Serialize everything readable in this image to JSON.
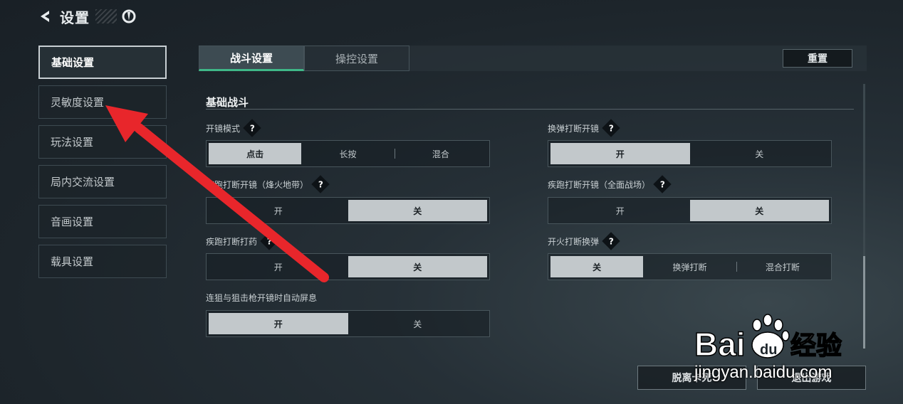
{
  "header": {
    "back_icon": "back-arrow-icon",
    "title": "设置",
    "logo_icon": "game-logo-icon"
  },
  "sidebar": {
    "items": [
      {
        "label": "基础设置",
        "active": true
      },
      {
        "label": "灵敏度设置"
      },
      {
        "label": "玩法设置"
      },
      {
        "label": "局内交流设置"
      },
      {
        "label": "音画设置"
      },
      {
        "label": "载具设置"
      }
    ]
  },
  "tabs": [
    {
      "label": "战斗设置",
      "active": true
    },
    {
      "label": "操控设置"
    }
  ],
  "reset_label": "重置",
  "section": {
    "title": "基础战斗"
  },
  "settings": {
    "scope_mode": {
      "label": "开镜模式",
      "options": [
        "点击",
        "长按",
        "混合"
      ],
      "selected": "点击"
    },
    "sprint_interrupt_scope_beacon": {
      "label": "疾跑打断开镜（烽火地带）",
      "options": [
        "开",
        "关"
      ],
      "selected": "关"
    },
    "sprint_interrupt_medicine": {
      "label": "疾跑打断打药",
      "options": [
        "开",
        "关"
      ],
      "selected": "关"
    },
    "auto_hold_breath": {
      "label": "连狙与狙击枪开镜时自动屏息",
      "options": [
        "开",
        "关"
      ],
      "selected": "开"
    },
    "reload_interrupt_scope": {
      "label": "换弹打断开镜",
      "options": [
        "开",
        "关"
      ],
      "selected": "开"
    },
    "sprint_interrupt_scope_full": {
      "label": "疾跑打断开镜（全面战场）",
      "options": [
        "开",
        "关"
      ],
      "selected": "关"
    },
    "fire_interrupt_reload": {
      "label": "开火打断换弹",
      "options": [
        "关",
        "换弹打断",
        "混合打断"
      ],
      "selected": "关"
    }
  },
  "help_glyph": "?",
  "bottom_buttons": {
    "leave": "脱离卡死",
    "exit": "退出游戏"
  },
  "watermark": {
    "text": "jingyan.baidu.com",
    "logo": "Bai 经验"
  },
  "colors": {
    "accent": "#3fb888",
    "annotation_arrow": "#e8262b"
  }
}
